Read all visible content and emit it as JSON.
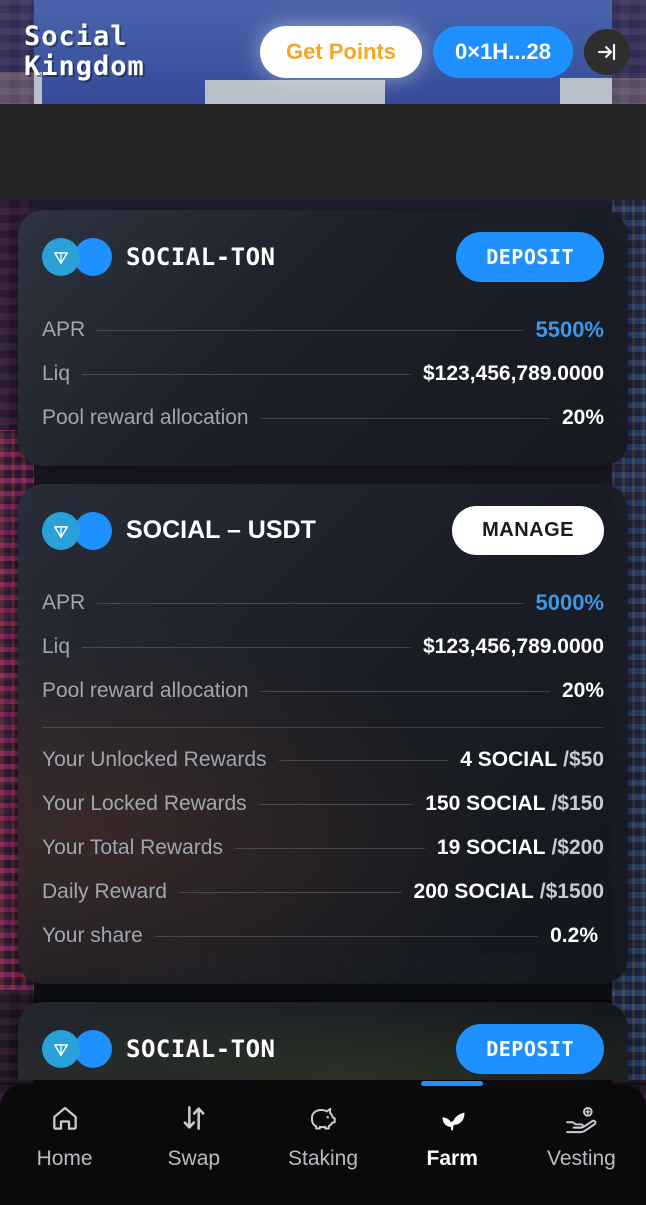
{
  "header": {
    "brand": "Social\nKingdom",
    "get_points_label": "Get Points",
    "wallet_label": "0×1H...28",
    "logout_icon": "logout-arrow-icon"
  },
  "pools": [
    {
      "pair": "SOCIAL-TON",
      "pair_style": "pixel",
      "action_label": "DEPOSIT",
      "action_style": "primary",
      "icons": [
        "ton-coin-icon",
        "social-coin-icon"
      ],
      "stats": [
        {
          "label": "APR",
          "value": "5500%",
          "accent": true
        },
        {
          "label": "Liq",
          "value": "$123,456,789.0000",
          "accent": false
        },
        {
          "label": "Pool reward allocation",
          "value": "20%",
          "accent": false
        }
      ],
      "rewards": []
    },
    {
      "pair": "SOCIAL – USDT",
      "pair_style": "plain",
      "action_label": "MANAGE",
      "action_style": "ghost",
      "icons": [
        "ton-coin-icon",
        "social-coin-icon"
      ],
      "stats": [
        {
          "label": "APR",
          "value": "5000%",
          "accent": true
        },
        {
          "label": "Liq",
          "value": "$123,456,789.0000",
          "accent": false
        },
        {
          "label": "Pool reward allocation",
          "value": "20%",
          "accent": false
        }
      ],
      "rewards": [
        {
          "label": "Your Unlocked Rewards",
          "value": "4 SOCIAL",
          "usd": "/$50"
        },
        {
          "label": "Your Locked Rewards",
          "value": "150 SOCIAL",
          "usd": "/$150"
        },
        {
          "label": "Your Total Rewards",
          "value": "19 SOCIAL",
          "usd": "/$200"
        },
        {
          "label": "Daily Reward",
          "value": "200 SOCIAL",
          "usd": "/$1500"
        },
        {
          "label": "Your share",
          "value": "0.2%",
          "usd": ""
        }
      ]
    },
    {
      "pair": "SOCIAL-TON",
      "pair_style": "pixel",
      "action_label": "DEPOSIT",
      "action_style": "primary",
      "icons": [
        "ton-coin-icon",
        "social-coin-icon"
      ],
      "stats": [],
      "rewards": []
    }
  ],
  "nav": {
    "active_index": 3,
    "items": [
      {
        "label": "Home",
        "icon": "home-icon"
      },
      {
        "label": "Swap",
        "icon": "swap-arrows-icon"
      },
      {
        "label": "Staking",
        "icon": "piggy-bank-icon"
      },
      {
        "label": "Farm",
        "icon": "sprout-leaf-icon"
      },
      {
        "label": "Vesting",
        "icon": "hand-coin-icon"
      }
    ]
  },
  "colors": {
    "accent_blue": "#1e90ff",
    "apr_blue": "#3e96e8",
    "points_orange": "#f5a623",
    "ton_blue": "#2aa0d8",
    "card_dark": "#232830",
    "nav_bg": "#0a0a0b"
  }
}
